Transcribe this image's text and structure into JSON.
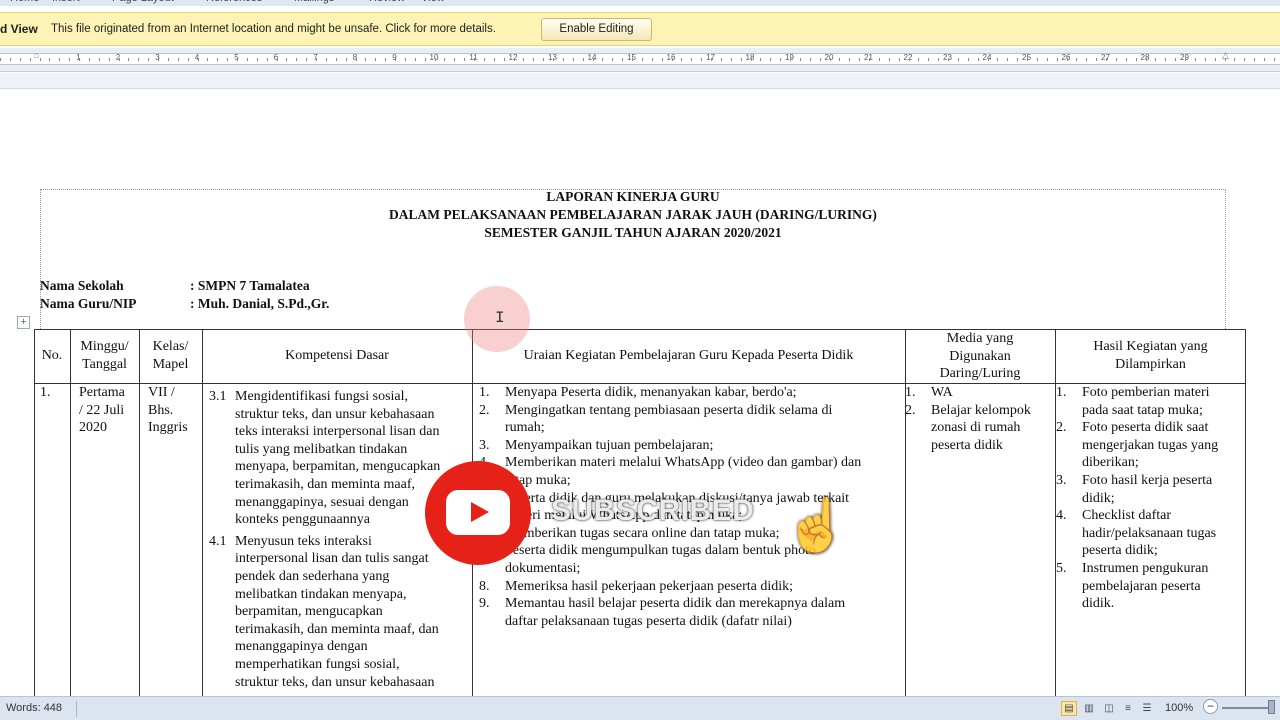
{
  "ribbon": {
    "tabs": [
      "Home",
      "Insert",
      "Page Layout",
      "References",
      "Mailings",
      "Review",
      "View"
    ]
  },
  "protected_view": {
    "title": "d View",
    "message": "This file originated from an Internet location and might be unsafe. Click for more details.",
    "button": "Enable Editing"
  },
  "ruler": {
    "numbers": [
      "1",
      "1",
      "2",
      "3",
      "4",
      "5",
      "6",
      "7",
      "8",
      "9",
      "10",
      "11",
      "12",
      "13",
      "14",
      "15",
      "16",
      "17",
      "18",
      "19",
      "20",
      "21",
      "22",
      "23",
      "24",
      "25",
      "26",
      "27",
      "28",
      "29"
    ]
  },
  "document": {
    "title_lines": [
      "LAPORAN KINERJA GURU",
      "DALAM PELAKSANAAN PEMBELAJARAN JARAK JAUH (DARING/LURING)",
      "SEMESTER GANJIL TAHUN AJARAN 2020/2021"
    ],
    "school_label": "Nama Sekolah",
    "school_value": ": SMPN 7 Tamalatea",
    "teacher_label": "Nama Guru/NIP",
    "teacher_value": ": Muh. Danial, S.Pd.,Gr.",
    "table": {
      "headers": {
        "no": "No.",
        "week": [
          "Minggu/",
          "Tanggal"
        ],
        "class": [
          "Kelas/",
          "Mapel"
        ],
        "kd": "Kompetensi Dasar",
        "activity": "Uraian Kegiatan Pembelajaran Guru Kepada Peserta Didik",
        "media": [
          "Media yang",
          "Digunakan",
          "Daring/Luring"
        ],
        "result": [
          "Hasil Kegiatan yang",
          "Dilampirkan"
        ]
      },
      "row1": {
        "no": "1.",
        "week": [
          "Pertama",
          "/ 22 Juli",
          "2020"
        ],
        "class": [
          "VII /",
          "Bhs.",
          "Inggris"
        ],
        "kd": [
          {
            "num": "3.1",
            "lines": [
              "Mengidentifikasi fungsi sosial,",
              "struktur teks, dan unsur kebahasaan",
              "teks interaksi interpersonal lisan dan",
              "tulis yang melibatkan tindakan",
              "menyapa, berpamitan, mengucapkan",
              "terimakasih, dan meminta maaf,",
              "menanggapinya, sesuai dengan",
              "konteks penggunaannya"
            ]
          },
          {
            "num": "4.1",
            "lines": [
              "Menyusun teks interaksi",
              "interpersonal lisan dan tulis sangat",
              "pendek dan sederhana yang",
              "melibatkan tindakan menyapa,",
              "berpamitan, mengucapkan",
              "terimakasih, dan meminta maaf, dan",
              "menanggapinya dengan",
              "memperhatikan fungsi sosial,",
              "struktur teks, dan unsur kebahasaan"
            ]
          }
        ],
        "activities": [
          {
            "num": "1.",
            "lines": [
              "Menyapa Peserta didik, menanyakan kabar, berdo'a;"
            ]
          },
          {
            "num": "2.",
            "lines": [
              "Mengingatkan tentang pembiasaan peserta didik selama di",
              "rumah;"
            ]
          },
          {
            "num": "3.",
            "lines": [
              "Menyampaikan tujuan pembelajaran;"
            ]
          },
          {
            "num": "4.",
            "lines": [
              "Memberikan materi melalui WhatsApp (video dan gambar) dan",
              "tatap muka;"
            ]
          },
          {
            "num": "5.",
            "lines": [
              "Peserta didik dan guru melakukan diskusi/tanya jawab terkait",
              "materi melalui WhatsApp dan tatap muka;"
            ]
          },
          {
            "num": "6.",
            "lines": [
              "Memberikan tugas secara online dan tatap muka;"
            ]
          },
          {
            "num": "7.",
            "lines": [
              "Peserta didik mengumpulkan tugas dalam bentuk photo",
              "dokumentasi;"
            ]
          },
          {
            "num": "8.",
            "lines": [
              "Memeriksa hasil pekerjaan pekerjaan peserta didik;"
            ]
          },
          {
            "num": "9.",
            "lines": [
              "Memantau hasil belajar peserta didik dan merekapnya dalam",
              "daftar pelaksanaan tugas peserta didik (dafatr nilai)"
            ]
          }
        ],
        "media": [
          {
            "num": "1.",
            "lines": [
              "WA"
            ]
          },
          {
            "num": "2.",
            "lines": [
              "Belajar kelompok",
              "zonasi di rumah",
              "peserta didik"
            ]
          }
        ],
        "results": [
          {
            "num": "1.",
            "lines": [
              "Foto pemberian materi",
              "pada saat tatap muka;"
            ]
          },
          {
            "num": "2.",
            "lines": [
              "Foto peserta didik saat",
              "mengerjakan tugas yang",
              "diberikan;"
            ]
          },
          {
            "num": "3.",
            "lines": [
              "Foto hasil kerja peserta",
              "didik;"
            ]
          },
          {
            "num": "4.",
            "lines": [
              "Checklist daftar",
              "hadir/pelaksanaan tugas",
              "peserta didik;"
            ]
          },
          {
            "num": "5.",
            "lines": [
              "Instrumen pengukuran",
              "pembelajaran peserta",
              "didik."
            ]
          }
        ]
      }
    }
  },
  "overlay": {
    "subscribed": "SUBSCRIBED"
  },
  "status_bar": {
    "words": "Words: 448",
    "zoom": "100%"
  }
}
